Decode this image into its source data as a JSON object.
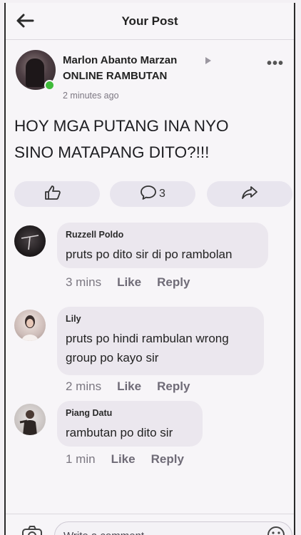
{
  "header": {
    "title": "Your Post",
    "back_icon": "arrow-left-icon"
  },
  "post": {
    "author": "Marlon Abanto Marzan",
    "group": "ONLINE RAMBUTAN",
    "time": "2 minutes ago",
    "text_line1": "HOY MGA PUTANG INA NYO",
    "text_line2": "SINO MATAPANG DITO?!!!",
    "more_icon": "•••",
    "online_color": "#3fbb3a"
  },
  "actions": {
    "like_icon": "thumbs-up-icon",
    "comment_icon": "comment-icon",
    "comment_count": "3",
    "share_icon": "share-icon"
  },
  "comments": [
    {
      "name": "Ruzzell Poldo",
      "lines": [
        "pruts po dito sir di po rambolan"
      ],
      "time": "3 mins",
      "like": "Like",
      "reply": "Reply"
    },
    {
      "name": "Lily",
      "lines": [
        "pruts po hindi rambulan wrong",
        "group po kayo sir"
      ],
      "time": "2 mins",
      "like": "Like",
      "reply": "Reply"
    },
    {
      "name": "Piang Datu",
      "lines": [
        "rambutan po dito sir"
      ],
      "time": "1 min",
      "like": "Like",
      "reply": "Reply"
    }
  ],
  "composer": {
    "placeholder": "Write a comment...",
    "camera_icon": "camera-icon",
    "emoji_icon": "emoji-icon"
  }
}
